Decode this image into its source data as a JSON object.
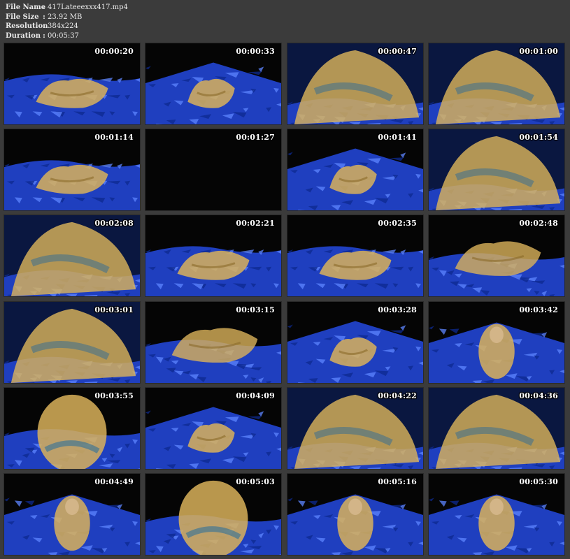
{
  "info": {
    "rows": [
      {
        "label": "File Name",
        "value": "417Lateeexxx417.mp4"
      },
      {
        "label": "File Size",
        "value": "23.92 MB"
      },
      {
        "label": "Resolution",
        "value": "384x224"
      },
      {
        "label": "Duration",
        "value": "00:05:37"
      }
    ],
    "separator": ":"
  },
  "thumbnails": [
    {
      "timestamp": "00:00:20",
      "scene": "sheet-low"
    },
    {
      "timestamp": "00:00:33",
      "scene": "sheet-mound"
    },
    {
      "timestamp": "00:00:47",
      "scene": "closeup"
    },
    {
      "timestamp": "00:01:00",
      "scene": "closeup"
    },
    {
      "timestamp": "00:01:14",
      "scene": "sheet-low"
    },
    {
      "timestamp": "00:01:27",
      "scene": "dark"
    },
    {
      "timestamp": "00:01:41",
      "scene": "sheet-mound"
    },
    {
      "timestamp": "00:01:54",
      "scene": "closeup"
    },
    {
      "timestamp": "00:02:08",
      "scene": "closeup"
    },
    {
      "timestamp": "00:02:21",
      "scene": "sheet-low"
    },
    {
      "timestamp": "00:02:35",
      "scene": "sheet-low"
    },
    {
      "timestamp": "00:02:48",
      "scene": "sheet-star"
    },
    {
      "timestamp": "00:03:01",
      "scene": "closeup"
    },
    {
      "timestamp": "00:03:15",
      "scene": "sheet-star"
    },
    {
      "timestamp": "00:03:28",
      "scene": "sheet-mound"
    },
    {
      "timestamp": "00:03:42",
      "scene": "figure"
    },
    {
      "timestamp": "00:03:55",
      "scene": "figure-close"
    },
    {
      "timestamp": "00:04:09",
      "scene": "sheet-mound"
    },
    {
      "timestamp": "00:04:22",
      "scene": "closeup"
    },
    {
      "timestamp": "00:04:36",
      "scene": "closeup"
    },
    {
      "timestamp": "00:04:49",
      "scene": "figure"
    },
    {
      "timestamp": "00:05:03",
      "scene": "figure-close"
    },
    {
      "timestamp": "00:05:16",
      "scene": "figure"
    },
    {
      "timestamp": "00:05:30",
      "scene": "figure"
    }
  ],
  "colors": {
    "background": "#3b3b3b",
    "latex": "#d9b25a",
    "latex_dark": "#8a6a2a",
    "plastic_blue": "#1f3fbf",
    "plastic_light": "#5e86ff",
    "frame_dark": "#050505"
  }
}
